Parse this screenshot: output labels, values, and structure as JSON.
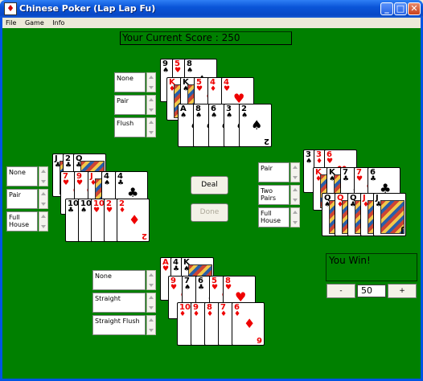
{
  "window": {
    "title": "Chinese Poker (Lap Lap Fu)",
    "app_icon": "cards-icon",
    "minimize": "_",
    "maximize": "□",
    "close": "✕"
  },
  "menu": {
    "items": [
      "File",
      "Game",
      "Info"
    ]
  },
  "score": {
    "text": "Your Current Score : 250"
  },
  "players": {
    "north": {
      "labels": [
        "None",
        "Pair",
        "Flush"
      ]
    },
    "west": {
      "labels": [
        "None",
        "Pair",
        "Full House"
      ]
    },
    "east": {
      "labels": [
        "Pair",
        "Two Pairs",
        "Full House"
      ]
    },
    "south": {
      "labels": [
        "None",
        "Straight",
        "Straight Flush"
      ]
    }
  },
  "cards": {
    "north": [
      {
        "rank": "9",
        "suit": "♠",
        "color": "blk"
      },
      {
        "rank": "5",
        "suit": "♥",
        "color": "red"
      },
      {
        "rank": "8",
        "suit": "♠",
        "color": "blk"
      },
      {
        "rank": "K",
        "suit": "♦",
        "color": "red",
        "face": true
      },
      {
        "rank": "K",
        "suit": "♠",
        "color": "blk",
        "face": true
      },
      {
        "rank": "5",
        "suit": "♥",
        "color": "red"
      },
      {
        "rank": "4",
        "suit": "♦",
        "color": "red"
      },
      {
        "rank": "4",
        "suit": "♥",
        "color": "red"
      },
      {
        "rank": "A",
        "suit": "♠",
        "color": "blk"
      },
      {
        "rank": "8",
        "suit": "♠",
        "color": "blk"
      },
      {
        "rank": "6",
        "suit": "♠",
        "color": "blk"
      },
      {
        "rank": "3",
        "suit": "♠",
        "color": "blk"
      },
      {
        "rank": "2",
        "suit": "♠",
        "color": "blk"
      }
    ],
    "west": [
      {
        "rank": "J",
        "suit": "♣",
        "color": "blk",
        "face": true
      },
      {
        "rank": "2",
        "suit": "♣",
        "color": "blk"
      },
      {
        "rank": "Q",
        "suit": "♣",
        "color": "blk",
        "face": true
      },
      {
        "rank": "7",
        "suit": "♥",
        "color": "red"
      },
      {
        "rank": "9",
        "suit": "♥",
        "color": "red"
      },
      {
        "rank": "J",
        "suit": "♦",
        "color": "red",
        "face": true
      },
      {
        "rank": "4",
        "suit": "♠",
        "color": "blk"
      },
      {
        "rank": "4",
        "suit": "♣",
        "color": "blk"
      },
      {
        "rank": "10",
        "suit": "♣",
        "color": "blk"
      },
      {
        "rank": "10",
        "suit": "♠",
        "color": "blk"
      },
      {
        "rank": "10",
        "suit": "♥",
        "color": "red"
      },
      {
        "rank": "2",
        "suit": "♥",
        "color": "red"
      },
      {
        "rank": "2",
        "suit": "♦",
        "color": "red"
      }
    ],
    "east": [
      {
        "rank": "3",
        "suit": "♠",
        "color": "blk"
      },
      {
        "rank": "3",
        "suit": "♦",
        "color": "red"
      },
      {
        "rank": "6",
        "suit": "♥",
        "color": "red"
      },
      {
        "rank": "K",
        "suit": "♦",
        "color": "red",
        "face": true
      },
      {
        "rank": "K",
        "suit": "♠",
        "color": "blk",
        "face": true
      },
      {
        "rank": "7",
        "suit": "♣",
        "color": "blk"
      },
      {
        "rank": "7",
        "suit": "♥",
        "color": "red"
      },
      {
        "rank": "6",
        "suit": "♣",
        "color": "blk"
      },
      {
        "rank": "Q",
        "suit": "♠",
        "color": "blk",
        "face": true
      },
      {
        "rank": "Q",
        "suit": "♦",
        "color": "red",
        "face": true
      },
      {
        "rank": "Q",
        "suit": "♣",
        "color": "blk",
        "face": true
      },
      {
        "rank": "J",
        "suit": "♦",
        "color": "red",
        "face": true
      },
      {
        "rank": "J",
        "suit": "♣",
        "color": "blk",
        "face": true
      }
    ],
    "south": [
      {
        "rank": "A",
        "suit": "♥",
        "color": "red"
      },
      {
        "rank": "4",
        "suit": "♣",
        "color": "blk"
      },
      {
        "rank": "K",
        "suit": "♠",
        "color": "blk",
        "face": true
      },
      {
        "rank": "9",
        "suit": "♥",
        "color": "red"
      },
      {
        "rank": "7",
        "suit": "♠",
        "color": "blk"
      },
      {
        "rank": "6",
        "suit": "♣",
        "color": "blk"
      },
      {
        "rank": "5",
        "suit": "♥",
        "color": "red"
      },
      {
        "rank": "8",
        "suit": "♥",
        "color": "red"
      },
      {
        "rank": "10",
        "suit": "♦",
        "color": "red"
      },
      {
        "rank": "9",
        "suit": "♦",
        "color": "red"
      },
      {
        "rank": "8",
        "suit": "♦",
        "color": "red"
      },
      {
        "rank": "7",
        "suit": "♦",
        "color": "red"
      },
      {
        "rank": "6",
        "suit": "♦",
        "color": "red"
      }
    ]
  },
  "buttons": {
    "deal": "Deal",
    "done": "Done"
  },
  "result": {
    "text": "You Win!"
  },
  "bet": {
    "decrease": "-",
    "value": "50",
    "increase": "+"
  },
  "colors": {
    "felt": "#008000",
    "titlebar": "#0a55d8"
  }
}
